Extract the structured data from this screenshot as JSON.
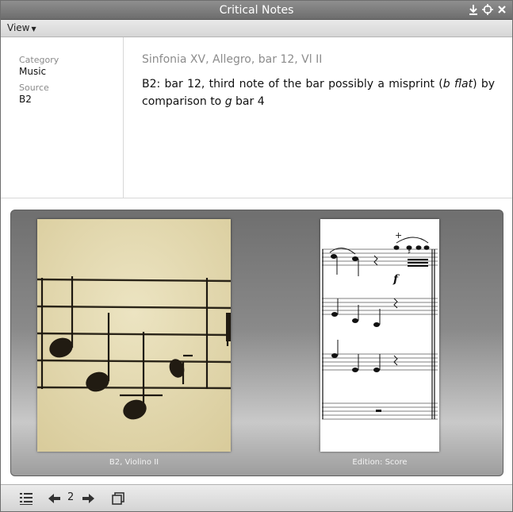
{
  "window": {
    "title": "Critical Notes"
  },
  "menubar": {
    "view_label": "View"
  },
  "info": {
    "category_label": "Category",
    "category_value": "Music",
    "source_label": "Source",
    "source_value": "B2"
  },
  "note": {
    "title": "Sinfonia XV, Allegro, bar 12, Vl II",
    "text_parts": {
      "p1": "B2: bar 12, third note of the bar possibly a misprint (",
      "em1": "b flat",
      "p2": ") by comparison to ",
      "em2": "g",
      "p3": " bar 4"
    }
  },
  "gallery": {
    "items": [
      {
        "caption": "B2, Violino II"
      },
      {
        "caption": "Edition: Score"
      }
    ],
    "score_marks": {
      "plus": "+",
      "forte": "f",
      "sharp": "♯"
    }
  },
  "bottombar": {
    "page": "2"
  }
}
